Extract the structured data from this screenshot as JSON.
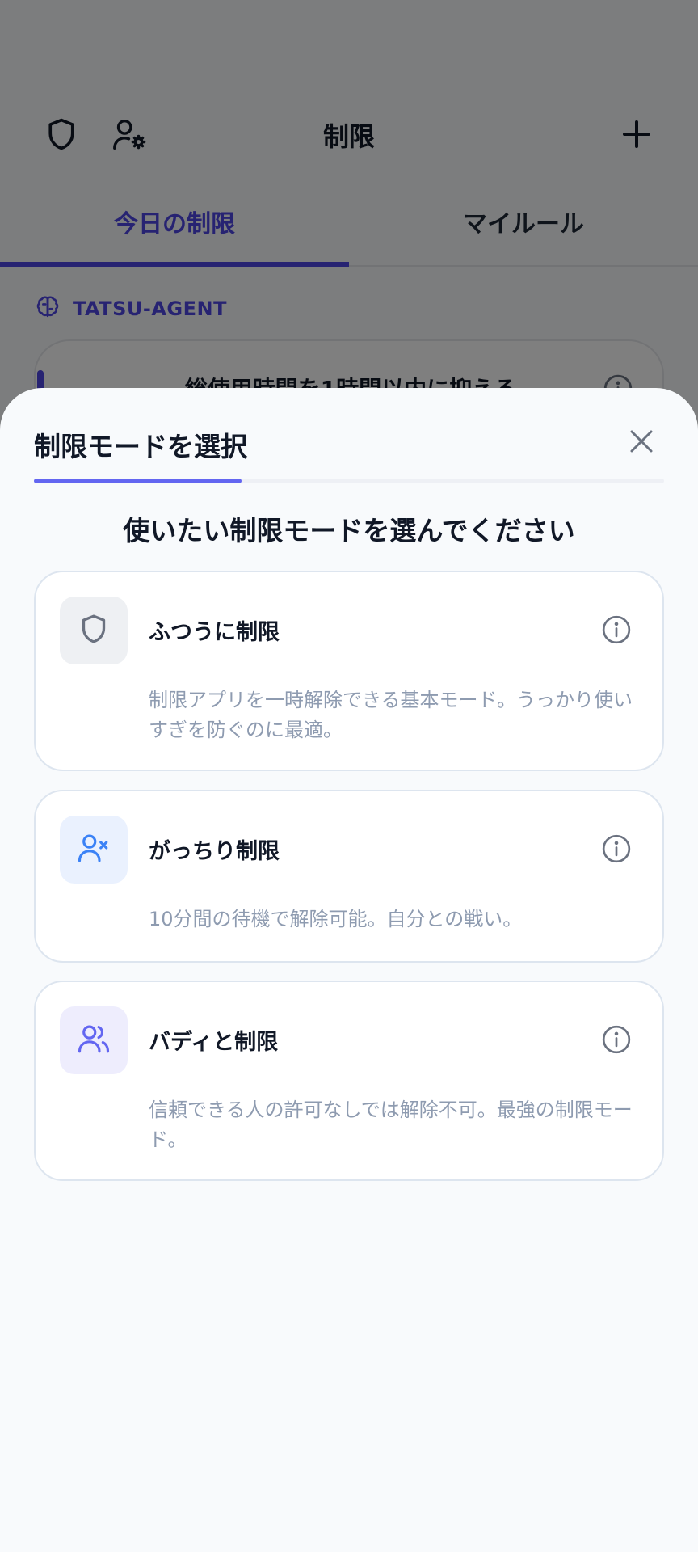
{
  "background": {
    "header_title": "制限",
    "tabs": [
      {
        "label": "今日の制限",
        "active": true
      },
      {
        "label": "マイルール",
        "active": false
      }
    ],
    "agent_label": "TATSU-AGENT",
    "rule_text": "総使用時間を1時間以内に抑える"
  },
  "sheet": {
    "title": "制限モードを選択",
    "prompt": "使いたい制限モードを選んでください",
    "progress": 0.33,
    "modes": [
      {
        "name": "ふつうに制限",
        "icon": "shield-icon",
        "description": "制限アプリを一時解除できる基本モード。うっかり使いすぎを防ぐのに最適。",
        "color": "#6b7280"
      },
      {
        "name": "がっちり制限",
        "icon": "user-x-icon",
        "description": "10分間の待機で解除可能。自分との戦い。",
        "color": "#3b82f6"
      },
      {
        "name": "バディと制限",
        "icon": "users-icon",
        "description": "信頼できる人の許可なしでは解除不可。最強の制限モード。",
        "color": "#6366f1"
      }
    ]
  },
  "colors": {
    "accent": "#4f46e5",
    "progress": "#6366f1",
    "muted_text": "#8e9bb0"
  }
}
